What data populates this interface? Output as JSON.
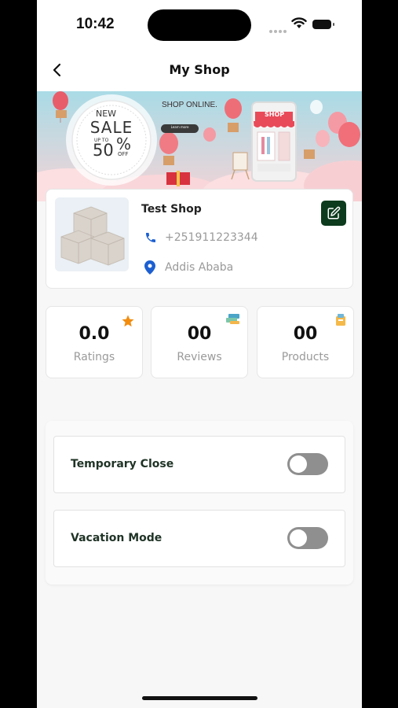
{
  "status_bar": {
    "time": "10:42"
  },
  "header": {
    "title": "My Shop"
  },
  "banner": {
    "badge_line1": "NEW",
    "badge_line2": "SALE",
    "badge_upto": "UP TO",
    "badge_percent": "50",
    "badge_off": "OFF",
    "headline": "SHOP ONLINE.",
    "button": "Learn more",
    "store_sign": "SHOP"
  },
  "shop": {
    "name": "Test Shop",
    "phone": "+251911223344",
    "location": "Addis Ababa"
  },
  "stats": [
    {
      "value": "0.0",
      "label": "Ratings",
      "icon": "star-icon"
    },
    {
      "value": "00",
      "label": "Reviews",
      "icon": "reviews-icon"
    },
    {
      "value": "00",
      "label": "Products",
      "icon": "products-icon"
    }
  ],
  "settings": [
    {
      "label": "Temporary Close",
      "enabled": false
    },
    {
      "label": "Vacation Mode",
      "enabled": false
    }
  ],
  "colors": {
    "primary": "#0c3b1d",
    "link_blue": "#1c5fd1",
    "star": "#f28c0f",
    "toggle_off": "#8f8f8f"
  }
}
